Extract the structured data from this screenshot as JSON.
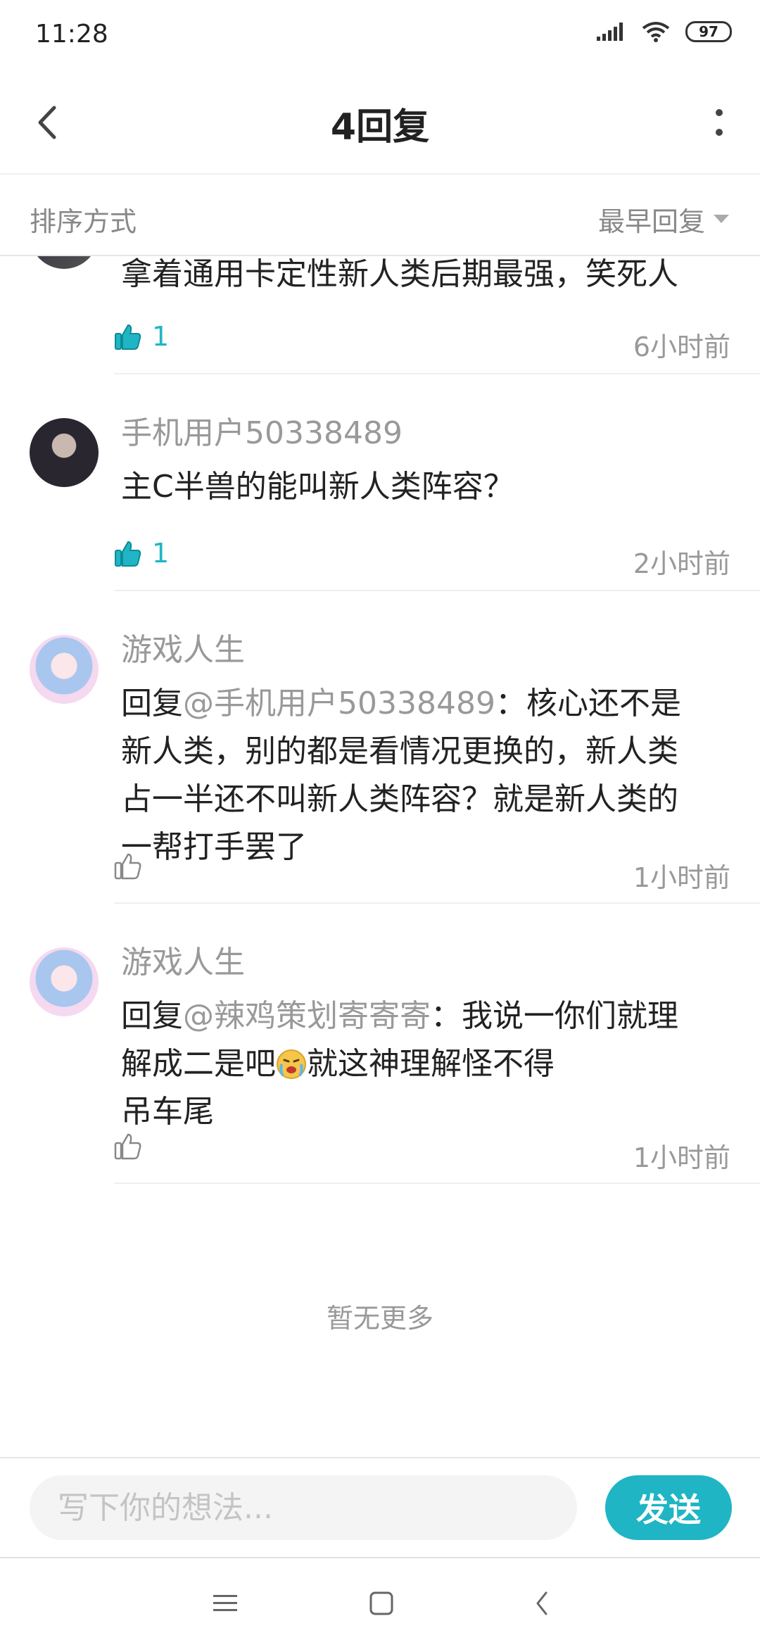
{
  "status_bar": {
    "time": "11:28",
    "battery": "97"
  },
  "header": {
    "title": "4回复"
  },
  "sort": {
    "label": "排序方式",
    "selected": "最早回复"
  },
  "comments": [
    {
      "text": "拿着通用卡定性新人类后期最强，笑死人",
      "likes": "1",
      "time": "6小时前"
    },
    {
      "username": "手机用户50338489",
      "text": "主C半兽的能叫新人类阵容？",
      "likes": "1",
      "time": "2小时前"
    },
    {
      "username": "游戏人生",
      "reply_prefix": "回复",
      "mention": "@手机用户50338489",
      "text_line1": "：核心还不是",
      "text_line2": "新人类，别的都是看情况更换的，新人类",
      "text_line3": "占一半还不叫新人类阵容？就是新人类的",
      "text_line4": "一帮打手罢了",
      "time": "1小时前"
    },
    {
      "username": "游戏人生",
      "reply_prefix": "回复",
      "mention": "@辣鸡策划寄寄寄",
      "text_line1": "：我说一你们就理",
      "text_line2a": "解成二是吧",
      "text_line2b": "就这神理解怪不得",
      "text_line3": "吊车尾",
      "time": "1小时前"
    }
  ],
  "footer_text": "暂无更多",
  "reply_bar": {
    "placeholder": "写下你的想法...",
    "send_label": "发送"
  },
  "colors": {
    "accent": "#1fb5c4",
    "muted_text": "#999999",
    "divider": "#efefef"
  },
  "icons": [
    "back-arrow-icon",
    "more-vertical-icon",
    "dropdown-triangle-icon",
    "thumbs-up-icon",
    "crying-emoji-icon",
    "menu-icon",
    "home-square-icon",
    "back-chevron-icon"
  ]
}
